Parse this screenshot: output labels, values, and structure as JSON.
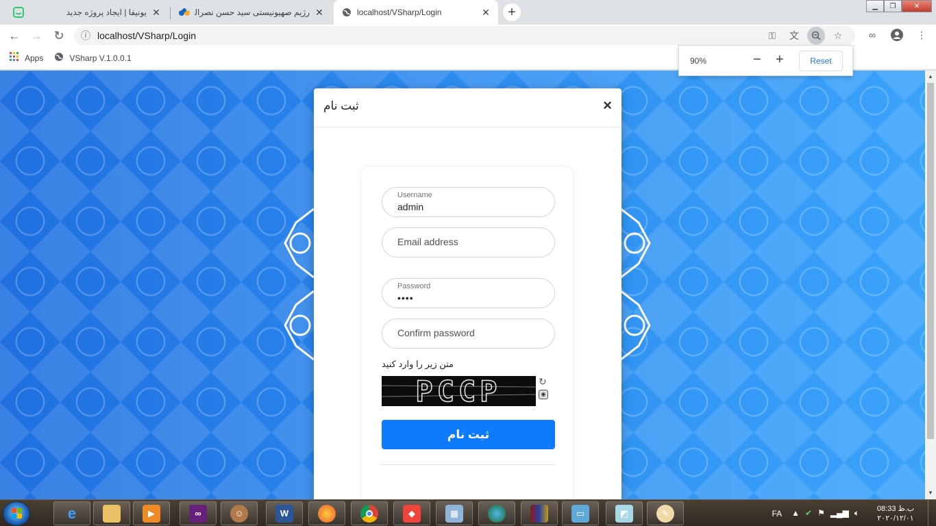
{
  "browser": {
    "tabs": [
      {
        "title": "یونیفا | ایجاد پروژه جدید",
        "active": false
      },
      {
        "title": "رژیم صهیونیستی سید حسن نصرالله را به ...",
        "active": false
      },
      {
        "title": "localhost/VSharp/Login",
        "active": true
      }
    ],
    "new_tab_label": "+",
    "url": "localhost/VSharp/Login",
    "bookmarks": [
      {
        "label": "Apps",
        "icon": "apps-grid-icon"
      },
      {
        "label": "VSharp V.1.0.0.1",
        "icon": "globe-icon"
      }
    ],
    "zoom_popup": {
      "value": "90%",
      "minus": "−",
      "plus": "+",
      "reset_label": "Reset"
    }
  },
  "modal": {
    "title": "ثبت نام",
    "close": "×"
  },
  "form": {
    "username": {
      "label": "Username",
      "value": "admin"
    },
    "email": {
      "placeholder": "Email address",
      "value": ""
    },
    "password": {
      "label": "Password",
      "value": "••••"
    },
    "confirm_password": {
      "placeholder": "Confirm password",
      "value": ""
    },
    "captcha_label": "متن زیر را وارد کنید",
    "captcha_text": "PCCP",
    "submit_label": "ثبت نام"
  },
  "taskbar": {
    "apps": [
      "internet-explorer",
      "file-explorer",
      "media-player",
      "visual-studio",
      "user-app",
      "word",
      "firefox",
      "chrome",
      "anydesk",
      "monitor-app",
      "internet-download-manager",
      "winrar",
      "image-viewer",
      "notepad-app",
      "paint-app"
    ],
    "language": "FA",
    "time": "08:33 ب.ظ",
    "date": "۲۰۲۰/۱۲/۰۱"
  },
  "colors": {
    "page_background": "#2a86ea",
    "submit_button": "#0d7bfb",
    "link_blue": "#1a73e8"
  }
}
